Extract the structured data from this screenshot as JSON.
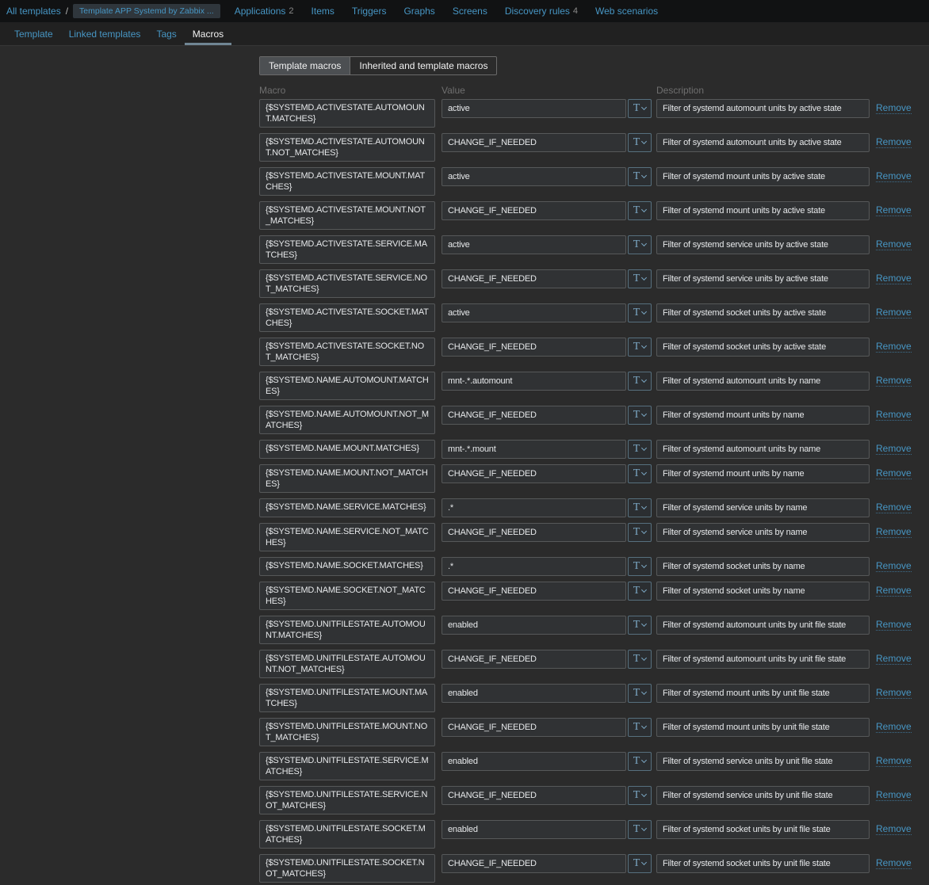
{
  "breadcrumb": {
    "root": "All templates",
    "separator": "/",
    "current": "Template APP Systemd by Zabbix ..."
  },
  "top_nav": {
    "items": [
      {
        "label": "Applications",
        "count": "2"
      },
      {
        "label": "Items",
        "count": ""
      },
      {
        "label": "Triggers",
        "count": ""
      },
      {
        "label": "Graphs",
        "count": ""
      },
      {
        "label": "Screens",
        "count": ""
      },
      {
        "label": "Discovery rules",
        "count": "4"
      },
      {
        "label": "Web scenarios",
        "count": ""
      }
    ]
  },
  "tabs": {
    "items": [
      {
        "label": "Template",
        "active": false
      },
      {
        "label": "Linked templates",
        "active": false
      },
      {
        "label": "Tags",
        "active": false
      },
      {
        "label": "Macros",
        "active": true
      }
    ]
  },
  "macro_view_toggle": {
    "options": [
      {
        "label": "Template macros",
        "selected": true
      },
      {
        "label": "Inherited and template macros",
        "selected": false
      }
    ]
  },
  "table": {
    "headers": {
      "macro": "Macro",
      "value": "Value",
      "description": "Description"
    },
    "type_button_label": "T",
    "remove_label": "Remove",
    "rows": [
      {
        "macro": "{$SYSTEMD.ACTIVESTATE.AUTOMOUNT.MATCHES}",
        "value": "active",
        "description": "Filter of systemd automount units by active state"
      },
      {
        "macro": "{$SYSTEMD.ACTIVESTATE.AUTOMOUNT.NOT_MATCHES}",
        "value": "CHANGE_IF_NEEDED",
        "description": "Filter of systemd automount units by active state"
      },
      {
        "macro": "{$SYSTEMD.ACTIVESTATE.MOUNT.MATCHES}",
        "value": "active",
        "description": "Filter of systemd mount units by active state"
      },
      {
        "macro": "{$SYSTEMD.ACTIVESTATE.MOUNT.NOT_MATCHES}",
        "value": "CHANGE_IF_NEEDED",
        "description": "Filter of systemd mount units by active state"
      },
      {
        "macro": "{$SYSTEMD.ACTIVESTATE.SERVICE.MATCHES}",
        "value": "active",
        "description": "Filter of systemd service units by active state"
      },
      {
        "macro": "{$SYSTEMD.ACTIVESTATE.SERVICE.NOT_MATCHES}",
        "value": "CHANGE_IF_NEEDED",
        "description": "Filter of systemd service units by active state"
      },
      {
        "macro": "{$SYSTEMD.ACTIVESTATE.SOCKET.MATCHES}",
        "value": "active",
        "description": "Filter of systemd socket units by active state"
      },
      {
        "macro": "{$SYSTEMD.ACTIVESTATE.SOCKET.NOT_MATCHES}",
        "value": "CHANGE_IF_NEEDED",
        "description": "Filter of systemd socket units by active state"
      },
      {
        "macro": "{$SYSTEMD.NAME.AUTOMOUNT.MATCHES}",
        "value": "mnt-.*.automount",
        "description": "Filter of systemd automount units by name"
      },
      {
        "macro": "{$SYSTEMD.NAME.AUTOMOUNT.NOT_MATCHES}",
        "value": "CHANGE_IF_NEEDED",
        "description": "Filter of systemd mount units by name"
      },
      {
        "macro": "{$SYSTEMD.NAME.MOUNT.MATCHES}",
        "value": "mnt-.*.mount",
        "description": "Filter of systemd automount units by name"
      },
      {
        "macro": "{$SYSTEMD.NAME.MOUNT.NOT_MATCHES}",
        "value": "CHANGE_IF_NEEDED",
        "description": "Filter of systemd mount units by name"
      },
      {
        "macro": "{$SYSTEMD.NAME.SERVICE.MATCHES}",
        "value": ".*",
        "description": "Filter of systemd service units by name"
      },
      {
        "macro": "{$SYSTEMD.NAME.SERVICE.NOT_MATCHES}",
        "value": "CHANGE_IF_NEEDED",
        "description": "Filter of systemd service units by name"
      },
      {
        "macro": "{$SYSTEMD.NAME.SOCKET.MATCHES}",
        "value": ".*",
        "description": "Filter of systemd socket units by name"
      },
      {
        "macro": "{$SYSTEMD.NAME.SOCKET.NOT_MATCHES}",
        "value": "CHANGE_IF_NEEDED",
        "description": "Filter of systemd socket units by name"
      },
      {
        "macro": "{$SYSTEMD.UNITFILESTATE.AUTOMOUNT.MATCHES}",
        "value": "enabled",
        "description": "Filter of systemd automount units by unit file state"
      },
      {
        "macro": "{$SYSTEMD.UNITFILESTATE.AUTOMOUNT.NOT_MATCHES}",
        "value": "CHANGE_IF_NEEDED",
        "description": "Filter of systemd automount units by unit file state"
      },
      {
        "macro": "{$SYSTEMD.UNITFILESTATE.MOUNT.MATCHES}",
        "value": "enabled",
        "description": "Filter of systemd mount units by unit file state"
      },
      {
        "macro": "{$SYSTEMD.UNITFILESTATE.MOUNT.NOT_MATCHES}",
        "value": "CHANGE_IF_NEEDED",
        "description": "Filter of systemd mount units by unit file state"
      },
      {
        "macro": "{$SYSTEMD.UNITFILESTATE.SERVICE.MATCHES}",
        "value": "enabled",
        "description": "Filter of systemd service units by unit file state"
      },
      {
        "macro": "{$SYSTEMD.UNITFILESTATE.SERVICE.NOT_MATCHES}",
        "value": "CHANGE_IF_NEEDED",
        "description": "Filter of systemd service units by unit file state"
      },
      {
        "macro": "{$SYSTEMD.UNITFILESTATE.SOCKET.MATCHES}",
        "value": "enabled",
        "description": "Filter of systemd socket units by unit file state"
      },
      {
        "macro": "{$SYSTEMD.UNITFILESTATE.SOCKET.NOT_MATCHES}",
        "value": "CHANGE_IF_NEEDED",
        "description": "Filter of systemd socket units by unit file state"
      }
    ]
  },
  "colors": {
    "link": "#4796c4",
    "tab_underline": "#708694",
    "selected_toggle_bg": "#4c4f52",
    "type_button_accent": "#7ba7c4",
    "topbar_bg": "#111213",
    "content_bg": "#2b2b2b"
  }
}
